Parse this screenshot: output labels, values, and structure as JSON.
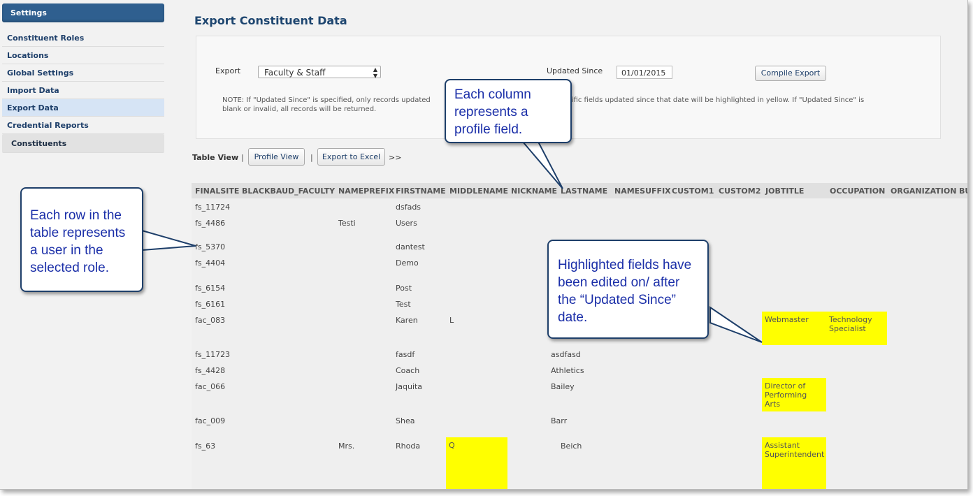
{
  "sidebar": {
    "header": "Settings",
    "items": [
      {
        "label": "Constituent Roles"
      },
      {
        "label": "Locations"
      },
      {
        "label": "Global Settings"
      },
      {
        "label": "Import Data"
      },
      {
        "label": "Export Data"
      },
      {
        "label": "Credential Reports"
      }
    ],
    "sub_item": "Constituents"
  },
  "page": {
    "title": "Export Constituent Data"
  },
  "export_form": {
    "export_label": "Export",
    "export_value": "Faculty & Staff",
    "updated_since_label": "Updated Since",
    "updated_since_value": "01/01/2015",
    "compile_button": "Compile Export",
    "note_line1": "NOTE: If \"Updated Since\" is specified, only records updated",
    "note_line1b": "pecific fields updated since that date will be highlighted in yellow. If \"Updated Since\" is",
    "note_line2": "blank or invalid, all records will be returned."
  },
  "toolbar": {
    "table_view": "Table View",
    "separator": "|",
    "profile_view": "Profile View",
    "export_excel": "Export to Excel",
    "more": ">>"
  },
  "table": {
    "columns": [
      "FINALSITE",
      "BLACKBAUD_FACULTY",
      "NAMEPREFIX",
      "FIRSTNAME",
      "MIDDLENAME",
      "NICKNAME",
      "LASTNAME",
      "NAMESUFFIX",
      "CUSTOM1",
      "CUSTOM2",
      "JOBTITLE",
      "OCCUPATION",
      "ORGANIZATION",
      "BU"
    ],
    "rows": [
      {
        "finalsite": "fs_11724",
        "nameprefix": "",
        "firstname": "dsfads",
        "middlename": "",
        "lastname": "",
        "jobtitle": "",
        "occupation": ""
      },
      {
        "finalsite": "fs_4486",
        "nameprefix": "Testi",
        "firstname": "Users",
        "middlename": "",
        "lastname": "",
        "jobtitle": "",
        "occupation": ""
      },
      {
        "finalsite": "fs_5370",
        "nameprefix": "",
        "firstname": "dantest",
        "middlename": "",
        "lastname": "",
        "jobtitle": "",
        "occupation": ""
      },
      {
        "finalsite": "fs_4404",
        "nameprefix": "",
        "firstname": "Demo",
        "middlename": "",
        "lastname": "",
        "jobtitle": "",
        "occupation": ""
      },
      {
        "finalsite": "fs_6154",
        "nameprefix": "",
        "firstname": "Post",
        "middlename": "",
        "lastname": "",
        "jobtitle": "",
        "occupation": ""
      },
      {
        "finalsite": "fs_6161",
        "nameprefix": "",
        "firstname": "Test",
        "middlename": "",
        "lastname": "",
        "jobtitle": "",
        "occupation": ""
      },
      {
        "finalsite": "fac_083",
        "nameprefix": "",
        "firstname": "Karen",
        "middlename": "L",
        "lastname": "",
        "jobtitle": "Webmaster",
        "occupation": "Technology Specialist"
      },
      {
        "finalsite": "fs_11723",
        "nameprefix": "",
        "firstname": "fasdf",
        "middlename": "",
        "lastname": "asdfasd",
        "jobtitle": "",
        "occupation": ""
      },
      {
        "finalsite": "fs_4428",
        "nameprefix": "",
        "firstname": "Coach",
        "middlename": "",
        "lastname": "Athletics",
        "jobtitle": "",
        "occupation": ""
      },
      {
        "finalsite": "fac_066",
        "nameprefix": "",
        "firstname": "Jaquita",
        "middlename": "",
        "lastname": "Bailey",
        "jobtitle": "Director of Performing Arts",
        "occupation": ""
      },
      {
        "finalsite": "fac_009",
        "nameprefix": "",
        "firstname": "Shea",
        "middlename": "",
        "lastname": "Barr",
        "jobtitle": "",
        "occupation": ""
      },
      {
        "finalsite": "fs_63",
        "nameprefix": "Mrs.",
        "firstname": "Rhoda",
        "middlename": "Q",
        "lastname": "Beich",
        "jobtitle": "Assistant Superintendent",
        "occupation": ""
      }
    ]
  },
  "callouts": {
    "column": "Each column represents a profile field.",
    "row": "Each row in the table represents a user in the selected role.",
    "highlight": "Highlighted fields have been edited on/ after the “Updated Since” date."
  },
  "colors": {
    "highlight": "#ffff00",
    "brand": "#2f5f8f",
    "callout_text": "#1a2ea8"
  }
}
